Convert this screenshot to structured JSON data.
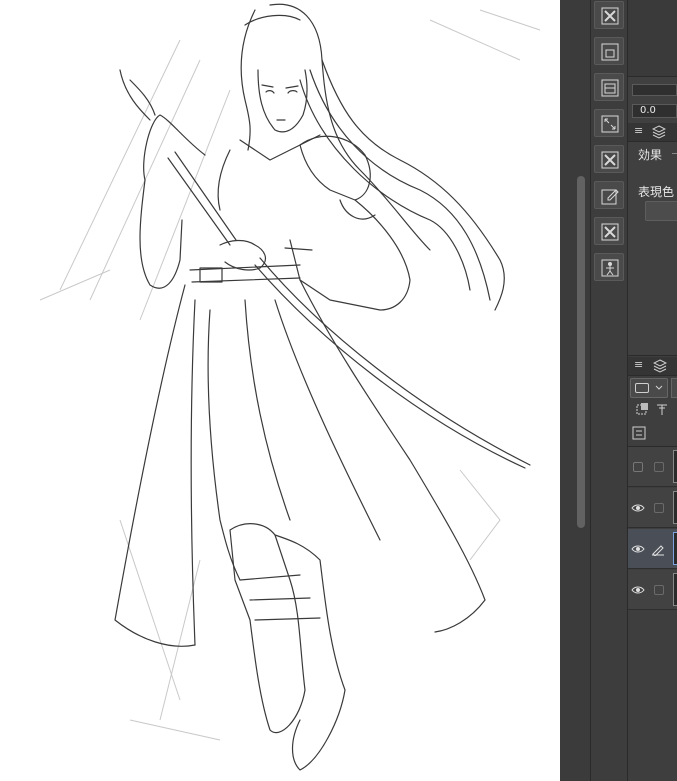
{
  "canvas": {
    "description_name": "sketch-canvas"
  },
  "command_bar": {
    "buttons": [
      {
        "icon": "x-box-icon"
      },
      {
        "icon": "frame-icon"
      },
      {
        "icon": "frame-icon"
      },
      {
        "icon": "resize-arrows-icon"
      },
      {
        "icon": "x-box-icon"
      },
      {
        "icon": "edit-square-icon"
      },
      {
        "icon": "x-box-icon"
      },
      {
        "icon": "figure-icon"
      }
    ]
  },
  "property_panel": {
    "value_field": "0.0",
    "effect_label": "効果",
    "expression_color_label": "表現色"
  },
  "layer_panel": {
    "rows": [
      {
        "visible": false,
        "selected": false
      },
      {
        "visible": true,
        "selected": false
      },
      {
        "visible": true,
        "selected": true
      },
      {
        "visible": true,
        "selected": false
      }
    ]
  },
  "colors": {
    "panel_bg": "#404040",
    "toolbar_bg": "#3d3d3d",
    "selection_accent": "#5a7bb5"
  }
}
